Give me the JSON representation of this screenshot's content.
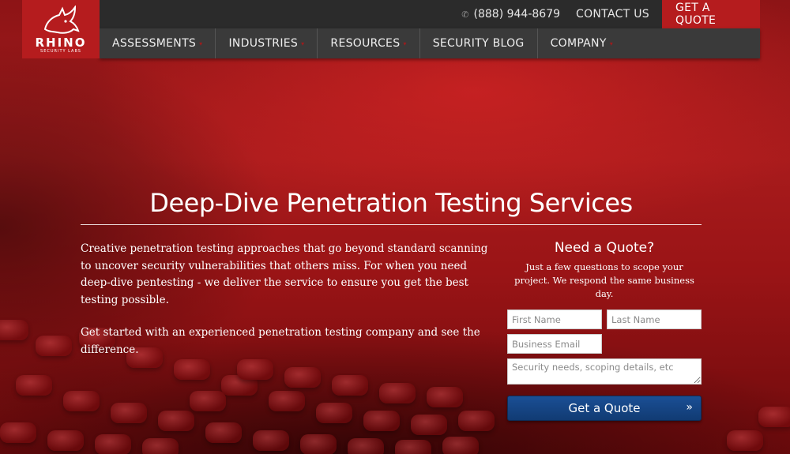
{
  "brand": {
    "logo_word": "RHINO",
    "logo_sub": "SECURITY LABS"
  },
  "topbar": {
    "phone": "(888) 944-8679",
    "contact_label": "CONTACT US",
    "quote_label": "GET A QUOTE"
  },
  "nav": {
    "items": [
      {
        "label": "ASSESSMENTS"
      },
      {
        "label": "INDUSTRIES"
      },
      {
        "label": "RESOURCES"
      },
      {
        "label": "SECURITY BLOG"
      },
      {
        "label": "COMPANY"
      }
    ]
  },
  "hero": {
    "title": "Deep-Dive Penetration Testing Services",
    "paragraph1": "Creative penetration testing approaches that go beyond standard scanning to uncover security vulnerabilities that others miss. For when you need deep-dive pentesting - we deliver the service to ensure you get the best testing possible.",
    "paragraph2": "Get started with an experienced penetration testing company and see the difference."
  },
  "form": {
    "title": "Need a Quote?",
    "subtitle": "Just a few questions to scope your project. We respond the same business day.",
    "first_name_placeholder": "First Name",
    "last_name_placeholder": "Last Name",
    "email_placeholder": "Business Email",
    "details_placeholder": "Security needs, scoping details, etc",
    "submit_label": "Get a Quote"
  },
  "colors": {
    "brand_red": "#b51c1e",
    "topbar_dark": "#2b2b2b",
    "nav_dark": "#3a3a3a",
    "submit_blue": "#1a4f95"
  }
}
